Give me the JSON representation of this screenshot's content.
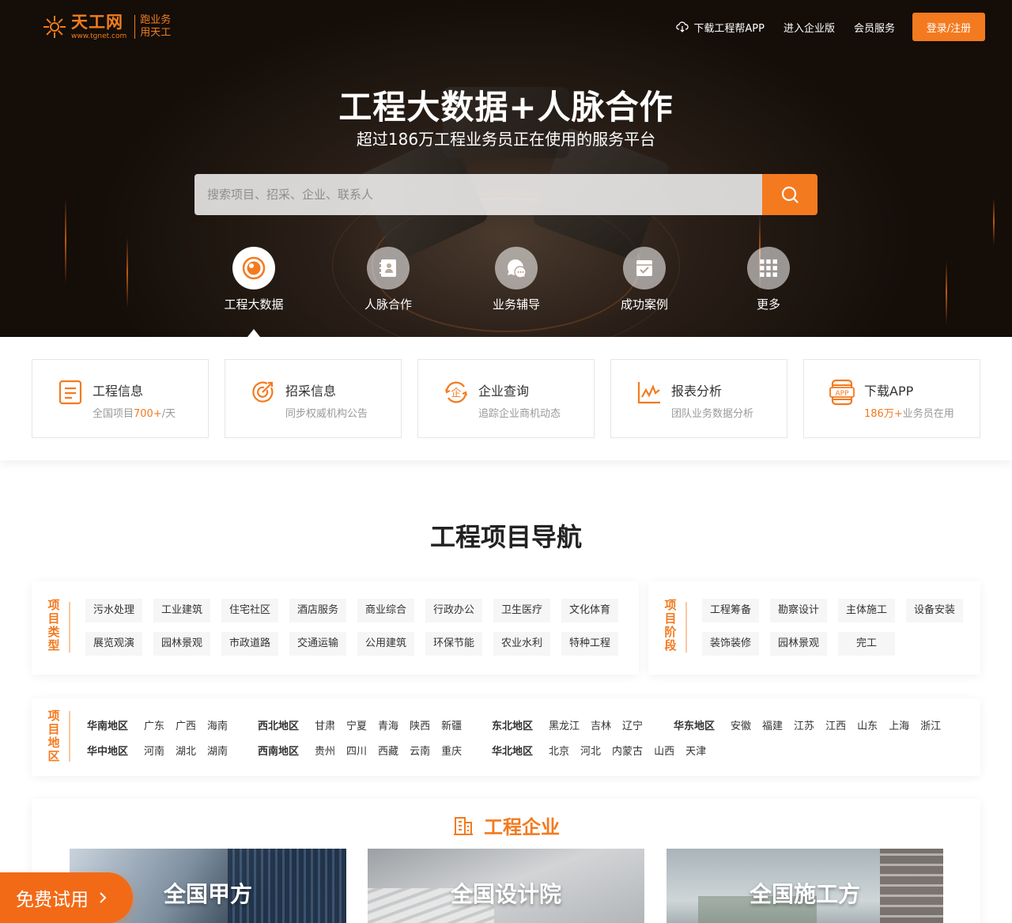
{
  "brand": {
    "name_cn": "天工网",
    "domain": "www.tgnet.com",
    "slogan_1": "跑业务",
    "slogan_2": "用天工",
    "accent": "#f47a1f"
  },
  "topnav": {
    "download_app": "下载工程帮APP",
    "enterprise": "进入企业版",
    "member": "会员服务",
    "login": "登录/注册"
  },
  "hero": {
    "title": "工程大数据+人脉合作",
    "subtitle": "超过186万工程业务员正在使用的服务平台",
    "search_placeholder": "搜索项目、招采、企业、联系人"
  },
  "categories": [
    {
      "label": "工程大数据",
      "icon": "data-eye-icon",
      "active": true
    },
    {
      "label": "人脉合作",
      "icon": "contacts-book-icon",
      "active": false
    },
    {
      "label": "业务辅导",
      "icon": "chat-bubbles-icon",
      "active": false
    },
    {
      "label": "成功案例",
      "icon": "inbox-check-icon",
      "active": false
    },
    {
      "label": "更多",
      "icon": "grid-dots-icon",
      "active": false
    }
  ],
  "features": [
    {
      "title": "工程信息",
      "desc_pre": "全国项目",
      "desc_hl": "700+",
      "desc_post": "/天",
      "icon": "document-icon"
    },
    {
      "title": "招采信息",
      "desc_pre": "同步权威机构公告",
      "desc_hl": "",
      "desc_post": "",
      "icon": "target-icon"
    },
    {
      "title": "企业查询",
      "desc_pre": "追踪企业商机动态",
      "desc_hl": "",
      "desc_post": "",
      "icon": "enterprise-icon"
    },
    {
      "title": "报表分析",
      "desc_pre": "团队业务数据分析",
      "desc_hl": "",
      "desc_post": "",
      "icon": "line-chart-icon"
    },
    {
      "title": "下载APP",
      "desc_pre": "",
      "desc_hl": "186万+",
      "desc_post": "业务员在用",
      "icon": "app-icon"
    }
  ],
  "nav_section": {
    "title": "工程项目导航",
    "type_label": "项目类型",
    "types_row1": [
      "污水处理",
      "工业建筑",
      "住宅社区",
      "酒店服务",
      "商业综合",
      "行政办公",
      "卫生医疗",
      "文化体育"
    ],
    "types_row2": [
      "展览观演",
      "园林景观",
      "市政道路",
      "交通运输",
      "公用建筑",
      "环保节能",
      "农业水利",
      "特种工程"
    ],
    "stage_label": "项目阶段",
    "stages_row1": [
      "工程筹备",
      "勘察设计",
      "主体施工",
      "设备安装"
    ],
    "stages_row2": [
      "装饰装修",
      "园林景观",
      "完工"
    ],
    "region_label": "项目地区",
    "regions_row1": [
      {
        "name": "华南地区",
        "provinces": [
          "广东",
          "广西",
          "海南"
        ]
      },
      {
        "name": "西北地区",
        "provinces": [
          "甘肃",
          "宁夏",
          "青海",
          "陕西",
          "新疆"
        ]
      },
      {
        "name": "东北地区",
        "provinces": [
          "黑龙江",
          "吉林",
          "辽宁"
        ]
      },
      {
        "name": "华东地区",
        "provinces": [
          "安徽",
          "福建",
          "江苏",
          "江西",
          "山东",
          "上海",
          "浙江"
        ]
      }
    ],
    "regions_row2": [
      {
        "name": "华中地区",
        "provinces": [
          "河南",
          "湖北",
          "湖南"
        ]
      },
      {
        "name": "西南地区",
        "provinces": [
          "贵州",
          "四川",
          "西藏",
          "云南",
          "重庆"
        ]
      },
      {
        "name": "华北地区",
        "provinces": [
          "北京",
          "河北",
          "内蒙古",
          "山西",
          "天津"
        ]
      }
    ]
  },
  "enterprise": {
    "title": "工程企业",
    "cards": [
      "全国甲方",
      "全国设计院",
      "全国施工方"
    ]
  },
  "trial": {
    "label": "免费试用"
  }
}
